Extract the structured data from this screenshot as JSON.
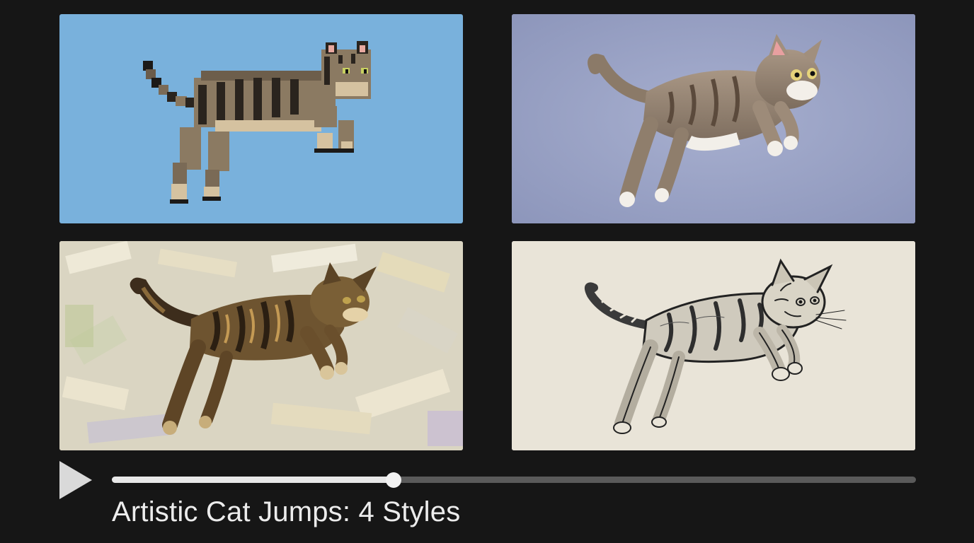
{
  "player": {
    "title": "Artistic Cat Jumps: 4 Styles",
    "progress_fraction": 0.35,
    "play_icon": "play-icon",
    "colors": {
      "background": "#161616",
      "track": "#5a5a5a",
      "track_fill": "#e8e8e8",
      "thumb": "#f2f2f2",
      "title_text": "#ececec"
    }
  },
  "tiles": [
    {
      "style": "pixel-art",
      "background": "#79b1dc"
    },
    {
      "style": "3d-render",
      "background": "#9aa3c6"
    },
    {
      "style": "oil-painting",
      "background": "#dcd8c6"
    },
    {
      "style": "pencil-sketch",
      "background": "#e9e4d8"
    }
  ]
}
